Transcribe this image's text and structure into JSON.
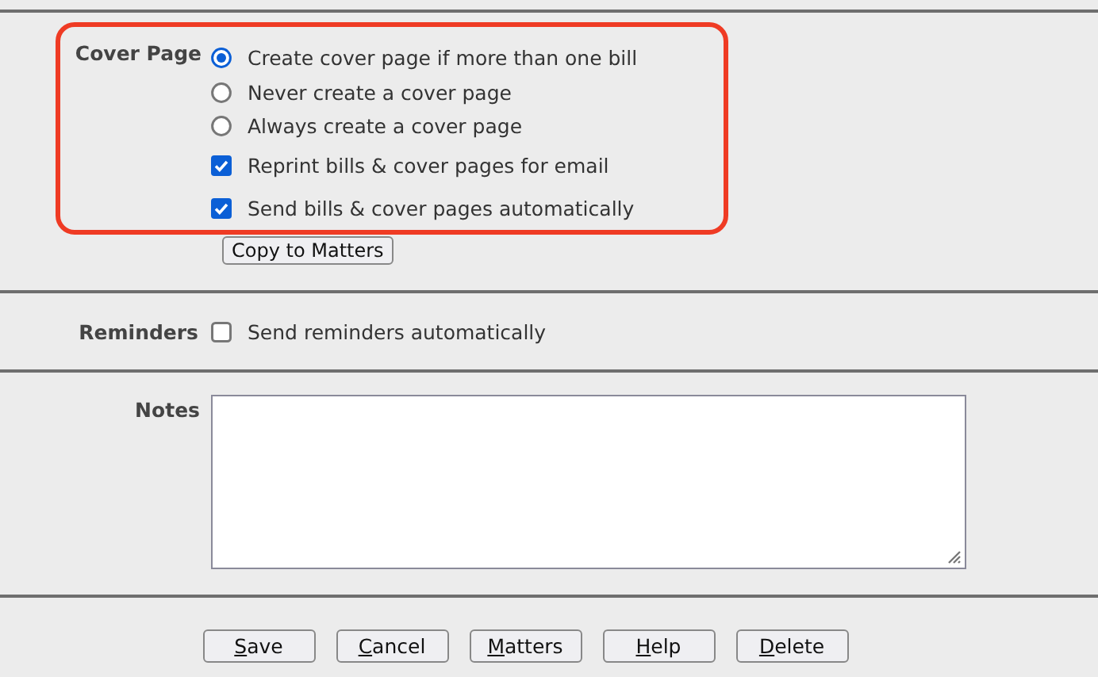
{
  "cover_page": {
    "label": "Cover Page",
    "highlighted": true,
    "options": [
      {
        "label": "Create cover page if more than one bill",
        "selected": true
      },
      {
        "label": "Never create a cover page",
        "selected": false
      },
      {
        "label": "Always create a cover page",
        "selected": false
      }
    ],
    "checkboxes": [
      {
        "label": "Reprint bills & cover pages for email",
        "checked": true
      },
      {
        "label": "Send bills & cover pages automatically",
        "checked": true
      }
    ],
    "copy_button": "Copy to Matters"
  },
  "reminders": {
    "label": "Reminders",
    "checkbox": {
      "label": "Send reminders automatically",
      "checked": false
    }
  },
  "notes": {
    "label": "Notes"
  },
  "buttons": [
    {
      "key": "S",
      "rest": "ave"
    },
    {
      "key": "C",
      "rest": "ancel"
    },
    {
      "key": "M",
      "rest": "atters"
    },
    {
      "key": "H",
      "rest": "elp"
    },
    {
      "key": "D",
      "rest": "elete"
    }
  ]
}
